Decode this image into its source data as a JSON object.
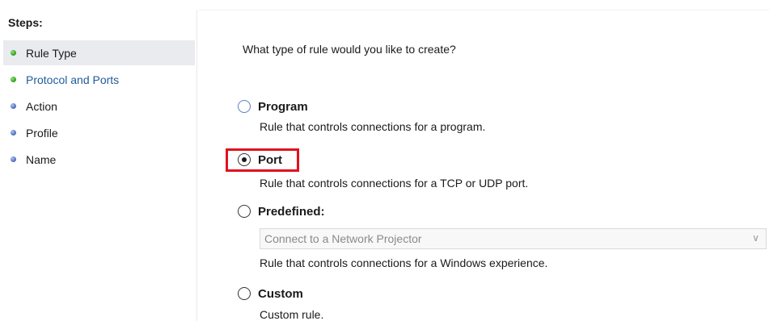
{
  "steps": {
    "header": "Steps:",
    "items": [
      {
        "label": "Rule Type",
        "bullet": "green",
        "state": "selected"
      },
      {
        "label": "Protocol and Ports",
        "bullet": "green",
        "state": "link"
      },
      {
        "label": "Action",
        "bullet": "blue",
        "state": "normal"
      },
      {
        "label": "Profile",
        "bullet": "blue",
        "state": "normal"
      },
      {
        "label": "Name",
        "bullet": "blue",
        "state": "normal"
      }
    ]
  },
  "content": {
    "question": "What type of rule would you like to create?",
    "options": [
      {
        "label": "Program",
        "description": "Rule that controls connections for a program.",
        "checked": false
      },
      {
        "label": "Port",
        "description": "Rule that controls connections for a TCP or UDP port.",
        "checked": true
      },
      {
        "label": "Predefined:",
        "description": "Rule that controls connections for a Windows experience.",
        "checked": false
      },
      {
        "label": "Custom",
        "description": "Custom rule.",
        "checked": false
      }
    ],
    "predefined_dropdown": {
      "value": "Connect to a Network Projector",
      "arrow_icon": "chevron-down-icon"
    }
  },
  "colors": {
    "highlight_border": "#e0121f",
    "link_text": "#1f5b9a",
    "bullet_green": "#3bab2b",
    "bullet_blue": "#5b79c8",
    "selected_step_bg": "#e9ebee"
  }
}
